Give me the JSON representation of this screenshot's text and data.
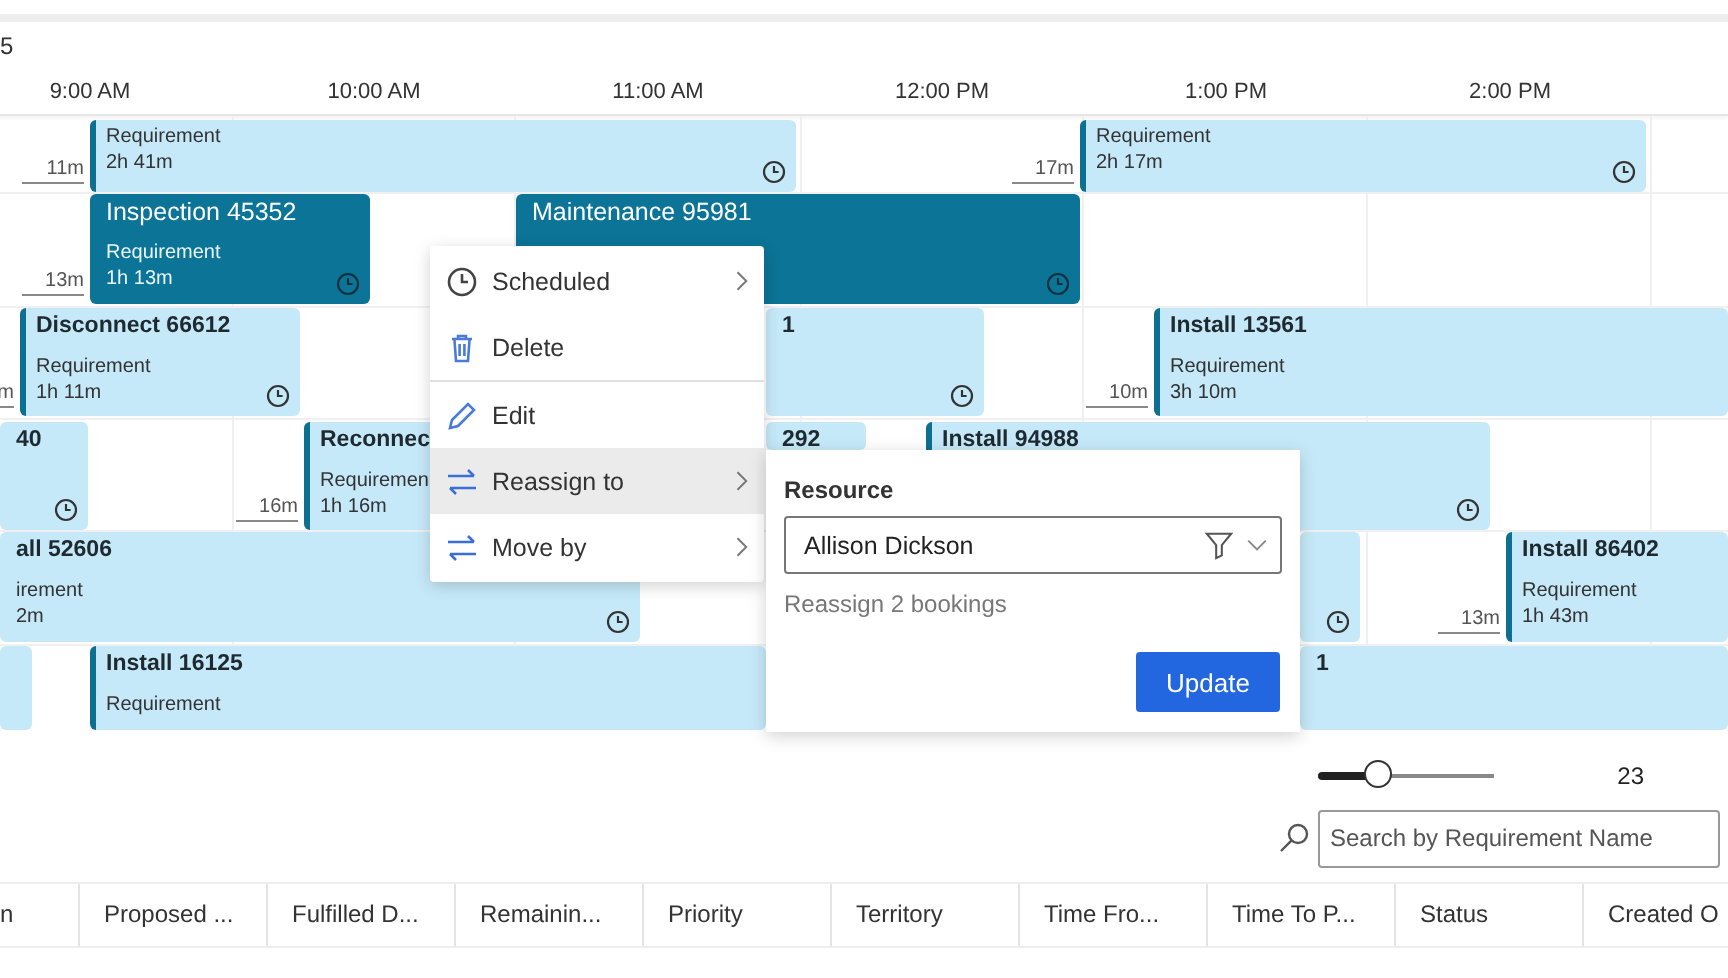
{
  "breadcrumb_fragment": "5",
  "time_scale": [
    "9:00 AM",
    "10:00 AM",
    "11:00 AM",
    "12:00 PM",
    "1:00 PM",
    "2:00 PM"
  ],
  "bookings": [
    {
      "subtitle": "Requirement",
      "duration": "2h 41m",
      "travel": "11m",
      "selected": false
    },
    {
      "subtitle": "Requirement",
      "duration": "2h 17m",
      "travel": "17m",
      "selected": false
    },
    {
      "title": "Inspection 45352",
      "subtitle": "Requirement",
      "duration": "1h 13m",
      "travel": "13m",
      "selected": true
    },
    {
      "title": "Maintenance 95981",
      "selected": true
    },
    {
      "title": "Disconnect 66612",
      "subtitle": "Requirement",
      "duration": "1h 11m",
      "travel": "m",
      "selected": false
    },
    {
      "title": "1",
      "selected": false
    },
    {
      "title": "Install 13561",
      "subtitle": "Requirement",
      "duration": "3h 10m",
      "travel": "10m",
      "selected": false
    },
    {
      "title": "40",
      "selected": false
    },
    {
      "title": "Reconnec",
      "subtitle": "Requiremen",
      "duration": "1h 16m",
      "travel": "16m",
      "selected": false
    },
    {
      "title": "292",
      "selected": false
    },
    {
      "title": "Install 94988",
      "selected": false
    },
    {
      "title": "all 52606",
      "subtitle": "irement",
      "duration": "2m",
      "selected": false
    },
    {
      "selected": false
    },
    {
      "title": "Install 86402",
      "subtitle": "Requirement",
      "duration": "1h 43m",
      "travel": "13m",
      "selected": false
    },
    {
      "selected": false
    },
    {
      "title": "Install 16125",
      "subtitle": "Requirement",
      "selected": false
    },
    {
      "title": "1",
      "selected": false
    }
  ],
  "context_menu": [
    {
      "label": "Scheduled",
      "kind": "clock",
      "submenu": true,
      "selected": false,
      "separator_before": false
    },
    {
      "label": "Delete",
      "kind": "trash",
      "submenu": false,
      "selected": false,
      "separator_before": false
    },
    {
      "label": "Edit",
      "kind": "pencil",
      "submenu": false,
      "selected": false,
      "separator_before": true
    },
    {
      "label": "Reassign to",
      "kind": "arrows",
      "submenu": true,
      "selected": true,
      "separator_before": false
    },
    {
      "label": "Move by",
      "kind": "arrows",
      "submenu": true,
      "selected": false,
      "separator_before": false
    }
  ],
  "reassign_panel": {
    "label": "Resource",
    "value": "Allison Dickson",
    "note": "Reassign 2 bookings",
    "button": "Update"
  },
  "zoom_slider": {
    "level": 0.35,
    "value": "23"
  },
  "search": {
    "placeholder": "Search by Requirement Name"
  },
  "table": {
    "columns": [
      "n",
      "Proposed ...",
      "Fulfilled D...",
      "Remainin...",
      "Priority",
      "Territory",
      "Time Fro...",
      "Time To P...",
      "Status",
      "Created O"
    ]
  }
}
